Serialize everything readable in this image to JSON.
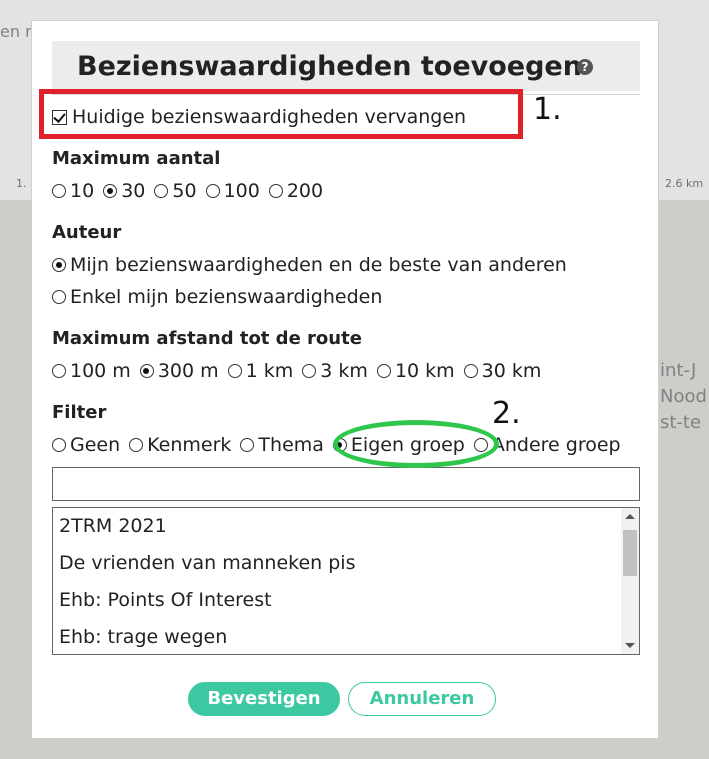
{
  "background": {
    "top_left_text": "en n",
    "axis_left": "1.",
    "axis_right": "2.6 km",
    "map_labels": [
      "int-J",
      "Nood",
      "st-te"
    ]
  },
  "dialog": {
    "title": "Bezienswaardigheden toevoegen",
    "help_icon": "?",
    "replace_checkbox": {
      "label": "Huidige bezienswaardigheden vervangen",
      "checked": true
    },
    "max_count": {
      "label": "Maximum aantal",
      "options": [
        "10",
        "30",
        "50",
        "100",
        "200"
      ],
      "selected": "30"
    },
    "author": {
      "label": "Auteur",
      "options": [
        "Mijn bezienswaardigheden en de beste van anderen",
        "Enkel mijn bezienswaardigheden"
      ],
      "selected": "Mijn bezienswaardigheden en de beste van anderen"
    },
    "max_distance": {
      "label": "Maximum afstand tot de route",
      "options": [
        "100 m",
        "300 m",
        "1 km",
        "3 km",
        "10 km",
        "30 km"
      ],
      "selected": "300 m"
    },
    "filter": {
      "label": "Filter",
      "options": [
        "Geen",
        "Kenmerk",
        "Thema",
        "Eigen groep",
        "Andere groep"
      ],
      "selected": "Eigen groep"
    },
    "search": {
      "value": "",
      "placeholder": ""
    },
    "groups": [
      "2TRM 2021",
      "De vrienden van manneken pis",
      "Ehb: Points Of Interest",
      "Ehb: trage wegen"
    ],
    "confirm_label": "Bevestigen",
    "cancel_label": "Annuleren"
  },
  "annotations": {
    "step1": "1.",
    "step2": "2."
  },
  "colors": {
    "accent": "#3cc8a0",
    "highlight_red": "#e0202a",
    "highlight_green": "#2ec74c"
  }
}
